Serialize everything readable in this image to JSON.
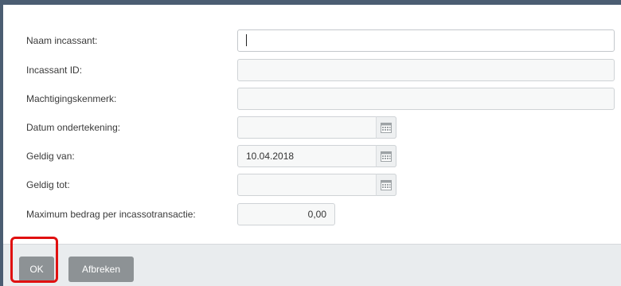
{
  "form": {
    "fields": [
      {
        "label": "Naam incassant:",
        "value": "",
        "type": "text"
      },
      {
        "label": "Incassant ID:",
        "value": "",
        "type": "text"
      },
      {
        "label": "Machtigingskenmerk:",
        "value": "",
        "type": "text"
      },
      {
        "label": "Datum ondertekening:",
        "value": "",
        "type": "date"
      },
      {
        "label": "Geldig van:",
        "value": "10.04.2018",
        "type": "date"
      },
      {
        "label": "Geldig tot:",
        "value": "",
        "type": "date"
      },
      {
        "label": "Maximum bedrag per incassotransactie:",
        "value": "0,00",
        "type": "money"
      }
    ]
  },
  "footer": {
    "ok_label": "OK",
    "cancel_label": "Afbreken"
  },
  "icons": {
    "calendar": "calendar-icon"
  },
  "colors": {
    "header_border": "#4b5d72",
    "button_bg": "#8d9295",
    "footer_bg": "#e9ecee",
    "highlight": "#e01010"
  }
}
